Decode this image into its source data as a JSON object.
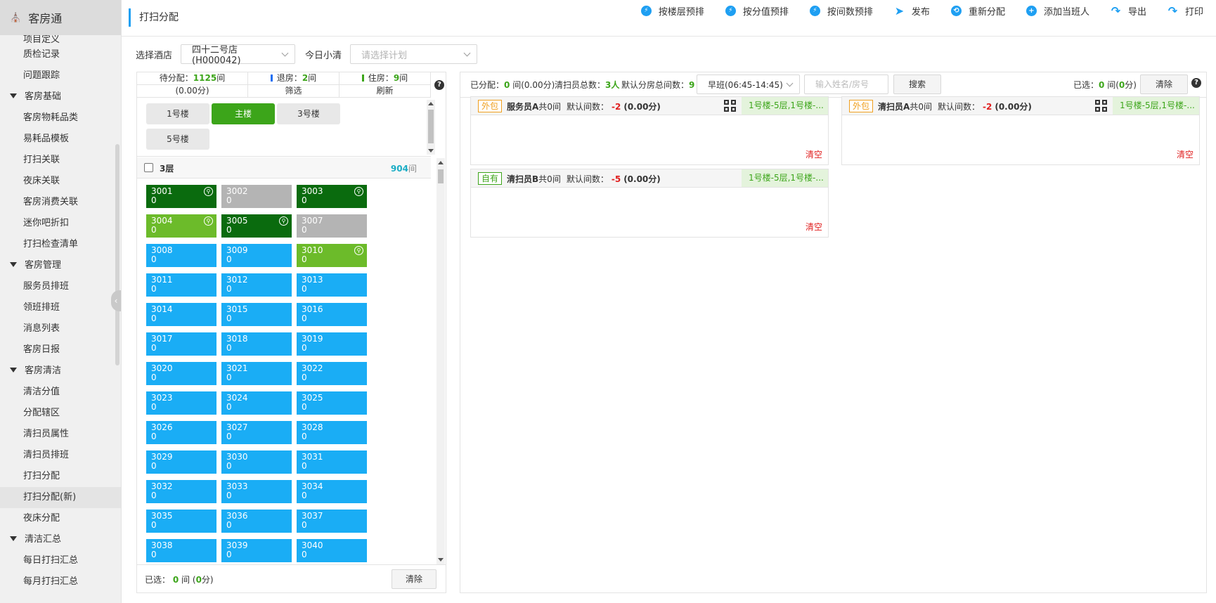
{
  "sidebar": {
    "title": "客房通",
    "home_icon": "home-icon",
    "items": [
      {
        "type": "item",
        "label": "项目定义"
      },
      {
        "type": "item",
        "label": "质检记录"
      },
      {
        "type": "item",
        "label": "问题跟踪"
      },
      {
        "type": "group",
        "label": "客房基础"
      },
      {
        "type": "item",
        "label": "客房物耗品类"
      },
      {
        "type": "item",
        "label": "易耗品模板"
      },
      {
        "type": "item",
        "label": "打扫关联"
      },
      {
        "type": "item",
        "label": "夜床关联"
      },
      {
        "type": "item",
        "label": "客房消费关联"
      },
      {
        "type": "item",
        "label": "迷你吧折扣"
      },
      {
        "type": "item",
        "label": "打扫检查清单"
      },
      {
        "type": "group",
        "label": "客房管理"
      },
      {
        "type": "item",
        "label": "服务员排班"
      },
      {
        "type": "item",
        "label": "领班排班"
      },
      {
        "type": "item",
        "label": "消息列表"
      },
      {
        "type": "item",
        "label": "客房日报"
      },
      {
        "type": "group",
        "label": "客房清洁"
      },
      {
        "type": "item",
        "label": "清洁分值"
      },
      {
        "type": "item",
        "label": "分配辖区"
      },
      {
        "type": "item",
        "label": "清扫员属性"
      },
      {
        "type": "item",
        "label": "清扫员排班"
      },
      {
        "type": "item",
        "label": "打扫分配"
      },
      {
        "type": "item",
        "label": "打扫分配(新)",
        "active": true
      },
      {
        "type": "item",
        "label": "夜床分配"
      },
      {
        "type": "group",
        "label": "清洁汇总"
      },
      {
        "type": "item",
        "label": "每日打扫汇总"
      },
      {
        "type": "item",
        "label": "每月打扫汇总"
      }
    ]
  },
  "header": {
    "title": "打扫分配",
    "toolbar": [
      {
        "label": "按楼层预排",
        "icon": "lightning-icon"
      },
      {
        "label": "按分值预排",
        "icon": "lightning-icon"
      },
      {
        "label": "按间数预排",
        "icon": "lightning-icon"
      },
      {
        "label": "发布",
        "icon": "send-icon"
      },
      {
        "label": "重新分配",
        "icon": "redistribute-icon"
      },
      {
        "label": "添加当班人",
        "icon": "add-circle-icon"
      },
      {
        "label": "导出",
        "icon": "share-arrow-icon"
      },
      {
        "label": "打印",
        "icon": "share-arrow-icon"
      }
    ]
  },
  "filters": {
    "hotel_label": "选择酒店",
    "hotel_value": "四十二号店(H000042)",
    "plan_label": "今日小清",
    "plan_placeholder": "请选择计划"
  },
  "left": {
    "pending_label": "待分配：",
    "pending_count": "1125",
    "pending_unit": "间",
    "checkout_label": "退房：",
    "checkout_count": "2",
    "checkout_unit": "间",
    "occupied_label": "住房：",
    "occupied_count": "9",
    "occupied_unit": "间",
    "score": "(0.00分)",
    "filter_label": "筛选",
    "refresh_label": "刷新",
    "buildings": [
      "1号楼",
      "主楼",
      "3号楼",
      "5号楼"
    ],
    "active_building": "主楼",
    "floor_label": "3层",
    "floor_count": "904",
    "floor_unit": "间",
    "selected_label": "已选：",
    "selected_count": "0",
    "selected_rooms_unit": "间",
    "selected_score_open": "(",
    "selected_score": "0",
    "selected_score_close": "分)",
    "clear_label": "清除",
    "rooms": [
      {
        "no": "3001",
        "val": "0",
        "color": "dark",
        "icon": true
      },
      {
        "no": "3002",
        "val": "0",
        "color": "gray",
        "icon": false
      },
      {
        "no": "3003",
        "val": "0",
        "color": "dark",
        "icon": true
      },
      {
        "no": "3004",
        "val": "0",
        "color": "light",
        "icon": true
      },
      {
        "no": "3005",
        "val": "0",
        "color": "dark",
        "icon": true
      },
      {
        "no": "3007",
        "val": "0",
        "color": "gray",
        "icon": false
      },
      {
        "no": "3008",
        "val": "0",
        "color": "blue",
        "icon": false
      },
      {
        "no": "3009",
        "val": "0",
        "color": "blue",
        "icon": false
      },
      {
        "no": "3010",
        "val": "0",
        "color": "light",
        "icon": true
      },
      {
        "no": "3011",
        "val": "0",
        "color": "blue",
        "icon": false
      },
      {
        "no": "3012",
        "val": "0",
        "color": "blue",
        "icon": false
      },
      {
        "no": "3013",
        "val": "0",
        "color": "blue",
        "icon": false
      },
      {
        "no": "3014",
        "val": "0",
        "color": "blue",
        "icon": false
      },
      {
        "no": "3015",
        "val": "0",
        "color": "blue",
        "icon": false
      },
      {
        "no": "3016",
        "val": "0",
        "color": "blue",
        "icon": false
      },
      {
        "no": "3017",
        "val": "0",
        "color": "blue",
        "icon": false
      },
      {
        "no": "3018",
        "val": "0",
        "color": "blue",
        "icon": false
      },
      {
        "no": "3019",
        "val": "0",
        "color": "blue",
        "icon": false
      },
      {
        "no": "3020",
        "val": "0",
        "color": "blue",
        "icon": false
      },
      {
        "no": "3021",
        "val": "0",
        "color": "blue",
        "icon": false
      },
      {
        "no": "3022",
        "val": "0",
        "color": "blue",
        "icon": false
      },
      {
        "no": "3023",
        "val": "0",
        "color": "blue",
        "icon": false
      },
      {
        "no": "3024",
        "val": "0",
        "color": "blue",
        "icon": false
      },
      {
        "no": "3025",
        "val": "0",
        "color": "blue",
        "icon": false
      },
      {
        "no": "3026",
        "val": "0",
        "color": "blue",
        "icon": false
      },
      {
        "no": "3027",
        "val": "0",
        "color": "blue",
        "icon": false
      },
      {
        "no": "3028",
        "val": "0",
        "color": "blue",
        "icon": false
      },
      {
        "no": "3029",
        "val": "0",
        "color": "blue",
        "icon": false
      },
      {
        "no": "3030",
        "val": "0",
        "color": "blue",
        "icon": false
      },
      {
        "no": "3031",
        "val": "0",
        "color": "blue",
        "icon": false
      },
      {
        "no": "3032",
        "val": "0",
        "color": "blue",
        "icon": false
      },
      {
        "no": "3033",
        "val": "0",
        "color": "blue",
        "icon": false
      },
      {
        "no": "3034",
        "val": "0",
        "color": "blue",
        "icon": false
      },
      {
        "no": "3035",
        "val": "0",
        "color": "blue",
        "icon": false
      },
      {
        "no": "3036",
        "val": "0",
        "color": "blue",
        "icon": false
      },
      {
        "no": "3037",
        "val": "0",
        "color": "blue",
        "icon": false
      },
      {
        "no": "3038",
        "val": "0",
        "color": "blue",
        "icon": false
      },
      {
        "no": "3039",
        "val": "0",
        "color": "blue",
        "icon": false
      },
      {
        "no": "3040",
        "val": "0",
        "color": "blue",
        "icon": false
      }
    ]
  },
  "right": {
    "assigned_label": "已分配：",
    "assigned_count": "0",
    "assigned_unit": " 间",
    "assigned_score": "(0.00分)",
    "cleaners_label": "清扫员总数：",
    "cleaners_count": "3人",
    "default_label": "默认分房总间数：",
    "default_count": "9",
    "shift_value": "早班(06:45-14:45)",
    "search_placeholder": "输入姓名/房号",
    "search_label": "搜索",
    "selected_label": "已选：",
    "selected_count": "0",
    "selected_rooms_unit": " 间",
    "selected_score_open": "(",
    "selected_score": "0",
    "selected_score_close": "分)",
    "clear_label": "清除",
    "cards": [
      {
        "tag": "外包",
        "tag_type": "orange",
        "name": "服务员A",
        "total_prefix": "共",
        "total": "0",
        "total_unit": "间",
        "default_label": "默认间数：",
        "default_val": "-2",
        "score": "(0.00分)",
        "area": "1号楼-5层,1号楼-...",
        "qr": true,
        "clear": "清空"
      },
      {
        "tag": "外包",
        "tag_type": "orange",
        "name": "清扫员A",
        "total_prefix": "共",
        "total": "0",
        "total_unit": "间",
        "default_label": "默认间数：",
        "default_val": "-2",
        "score": "(0.00分)",
        "area": "1号楼-5层,1号楼-...",
        "qr": true,
        "clear": "清空"
      },
      {
        "tag": "自有",
        "tag_type": "green",
        "name": "清扫员B",
        "total_prefix": "共",
        "total": "0",
        "total_unit": "间",
        "default_label": "默认间数：",
        "default_val": "-5",
        "score": "(0.00分)",
        "area": "1号楼-5层,1号楼-...",
        "qr": false,
        "clear": "清空"
      }
    ]
  },
  "colors": {
    "accent": "#1e9ff2",
    "green": "#3ca51a",
    "dark_green": "#0a6b0e",
    "light_green": "#6cbb2a",
    "room_blue": "#1aadf5",
    "room_gray": "#b4b4b4",
    "red": "#e02020",
    "orange": "#f0a020"
  }
}
